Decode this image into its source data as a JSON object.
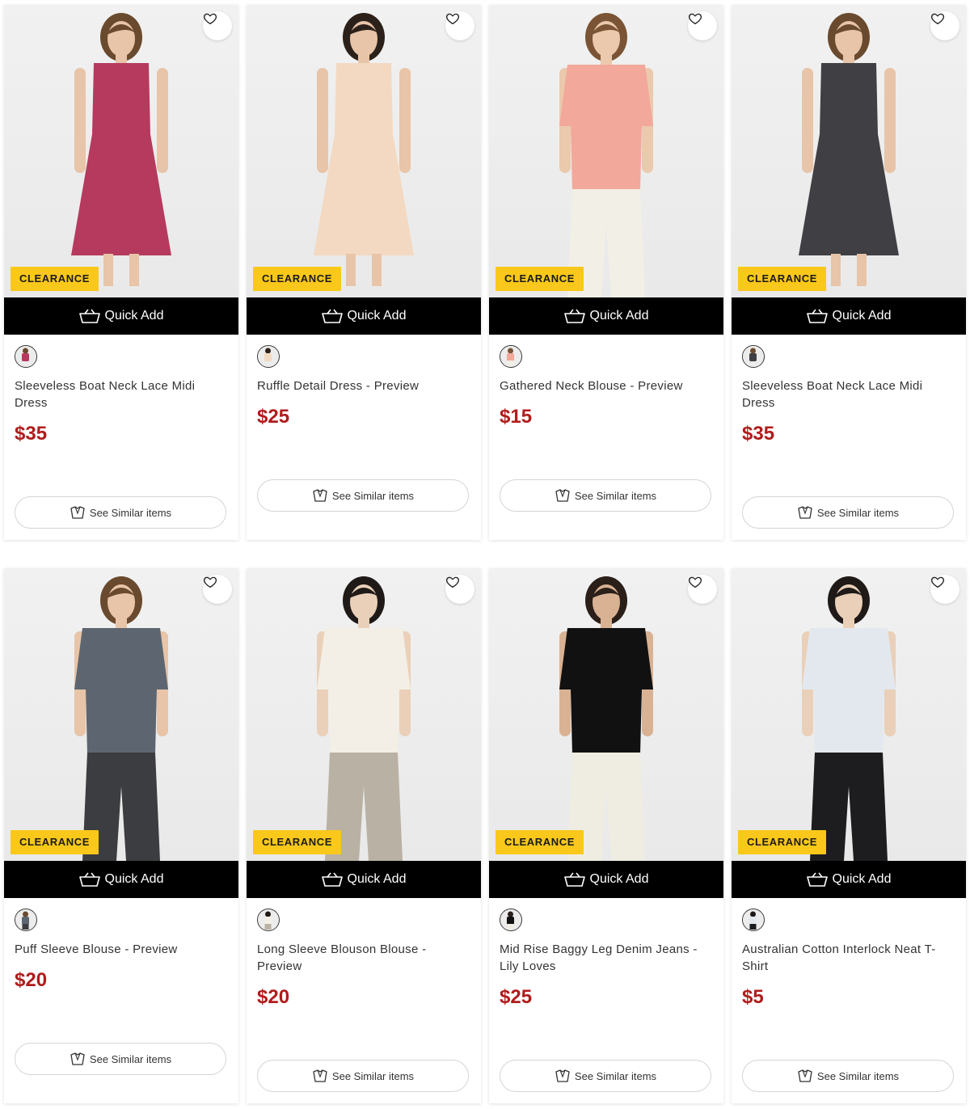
{
  "colors": {
    "badge_bg": "#f9c81a",
    "price": "#b01c1c",
    "quick_add_bg": "#000000"
  },
  "products": [
    {
      "title": "Sleeveless Boat Neck Lace Midi Dress",
      "price": "$35",
      "badge": "CLEARANCE",
      "quick_add": "Quick Add",
      "similar": "See Similar items",
      "garment": "#b53a5e",
      "pants": null,
      "hair": "#6a4a2e",
      "skin": "#e8c4a8"
    },
    {
      "title": "Ruffle Detail Dress - Preview",
      "price": "$25",
      "badge": "CLEARANCE",
      "quick_add": "Quick Add",
      "similar": "See Similar items",
      "garment": "#f3d9c2",
      "pants": null,
      "hair": "#2c211a",
      "skin": "#e8c4a8"
    },
    {
      "title": "Gathered Neck Blouse - Preview",
      "price": "$15",
      "badge": "CLEARANCE",
      "quick_add": "Quick Add",
      "similar": "See Similar items",
      "garment": "#f2a89a",
      "pants": "#f2efe6",
      "hair": "#7a5434",
      "skin": "#ebc9ad"
    },
    {
      "title": "Sleeveless Boat Neck Lace Midi Dress",
      "price": "$35",
      "badge": "CLEARANCE",
      "quick_add": "Quick Add",
      "similar": "See Similar items",
      "garment": "#3f3f44",
      "pants": null,
      "hair": "#6a4a2e",
      "skin": "#e8c4a8"
    },
    {
      "title": "Puff Sleeve Blouse - Preview",
      "price": "$20",
      "badge": "CLEARANCE",
      "quick_add": "Quick Add",
      "similar": "See Similar items",
      "garment": "#5d6670",
      "pants": "#3c3d40",
      "hair": "#6a4a2e",
      "skin": "#e8c4a8"
    },
    {
      "title": "Long Sleeve Blouson Blouse - Preview",
      "price": "$20",
      "badge": "CLEARANCE",
      "quick_add": "Quick Add",
      "similar": "See Similar items",
      "garment": "#f3efe6",
      "pants": "#b9b1a3",
      "hair": "#1f1a18",
      "skin": "#ead0b8"
    },
    {
      "title": "Mid Rise Baggy Leg Denim Jeans - Lily Loves",
      "price": "$25",
      "badge": "CLEARANCE",
      "quick_add": "Quick Add",
      "similar": "See Similar items",
      "garment": "#111111",
      "pants": "#efede2",
      "hair": "#2a1f19",
      "skin": "#d9b294"
    },
    {
      "title": "Australian Cotton Interlock Neat T-Shirt",
      "price": "$5",
      "badge": "CLEARANCE",
      "quick_add": "Quick Add",
      "similar": "See Similar items",
      "garment": "#e3e8ef",
      "pants": "#1d1d1f",
      "hair": "#1f1a18",
      "skin": "#ead0b8"
    }
  ]
}
